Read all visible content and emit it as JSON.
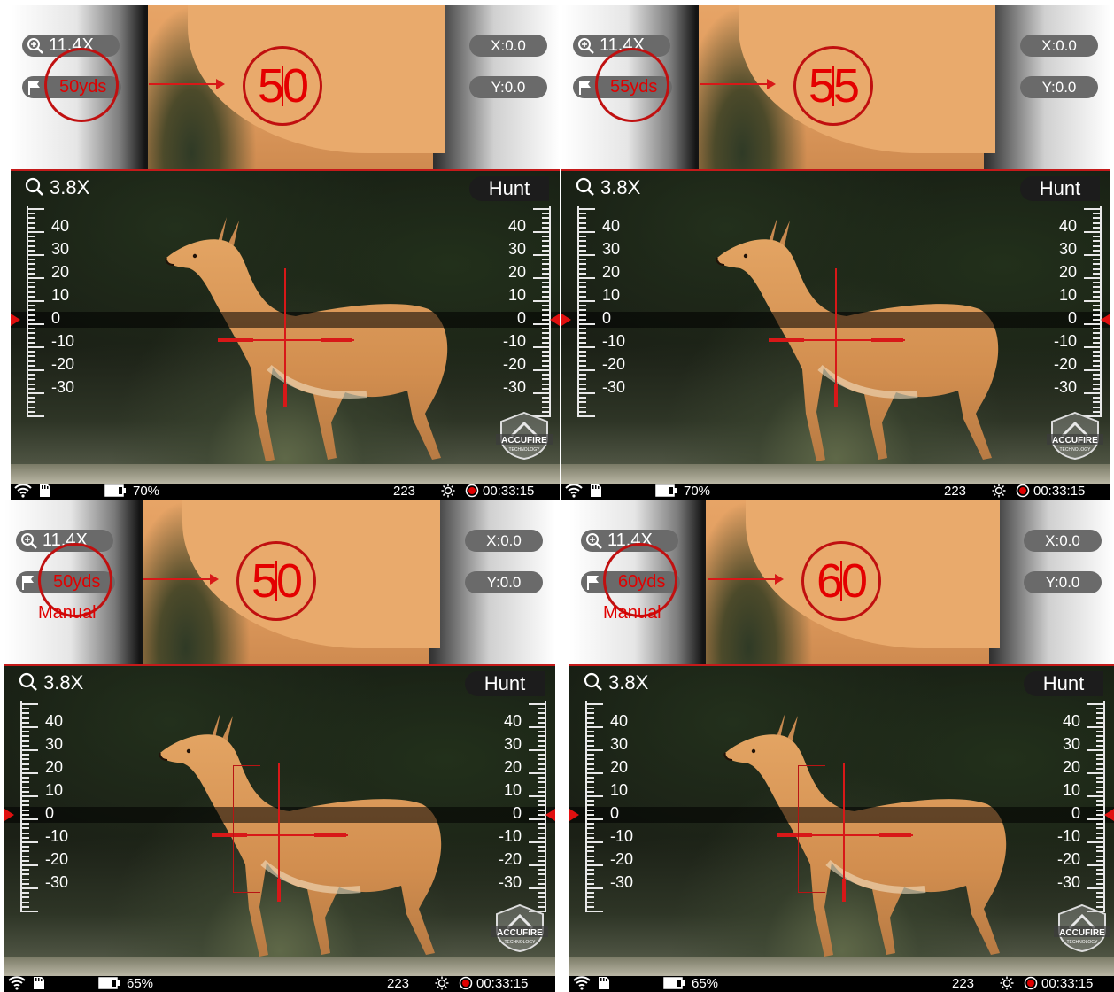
{
  "screens": [
    {
      "inset": {
        "zoom": "11.4X",
        "range": "50yds",
        "manual": "",
        "x": "X:0.0",
        "y": "Y:0.0",
        "big_left": "5",
        "big_right": "0"
      },
      "main": {
        "zoom": "3.8X",
        "mode": "Hunt"
      },
      "status": {
        "battery": "70%",
        "ammo": "223",
        "time": "00:33:15"
      },
      "bracket": false
    },
    {
      "inset": {
        "zoom": "11.4X",
        "range": "55yds",
        "manual": "",
        "x": "X:0.0",
        "y": "Y:0.0",
        "big_left": "5",
        "big_right": "5"
      },
      "main": {
        "zoom": "3.8X",
        "mode": "Hunt"
      },
      "status": {
        "battery": "70%",
        "ammo": "223",
        "time": "00:33:15"
      },
      "bracket": false
    },
    {
      "inset": {
        "zoom": "11.4X",
        "range": "50yds",
        "manual": "Manual",
        "x": "X:0.0",
        "y": "Y:0.0",
        "big_left": "5",
        "big_right": "0"
      },
      "main": {
        "zoom": "3.8X",
        "mode": "Hunt"
      },
      "status": {
        "battery": "65%",
        "ammo": "223",
        "time": "00:33:15"
      },
      "bracket": true
    },
    {
      "inset": {
        "zoom": "11.4X",
        "range": "60yds",
        "manual": "Manual",
        "x": "X:0.0",
        "y": "Y:0.0",
        "big_left": "6",
        "big_right": "0"
      },
      "main": {
        "zoom": "3.8X",
        "mode": "Hunt"
      },
      "status": {
        "battery": "65%",
        "ammo": "223",
        "time": "00:33:15"
      },
      "bracket": true
    }
  ],
  "scale_labels": [
    "40",
    "30",
    "20",
    "10",
    "0",
    "-10",
    "-20",
    "-30"
  ],
  "logo": {
    "line1": "ACCUFIRE",
    "line2": "TECHNOLOGY"
  },
  "colors": {
    "reticle": "#d81818",
    "accent": "#e00000",
    "pill": "#6a6a6a"
  },
  "icons": [
    "zoom-in-icon",
    "flag-icon",
    "search-icon",
    "wifi-icon",
    "sd-card-icon",
    "battery-icon",
    "brightness-icon",
    "record-icon"
  ]
}
